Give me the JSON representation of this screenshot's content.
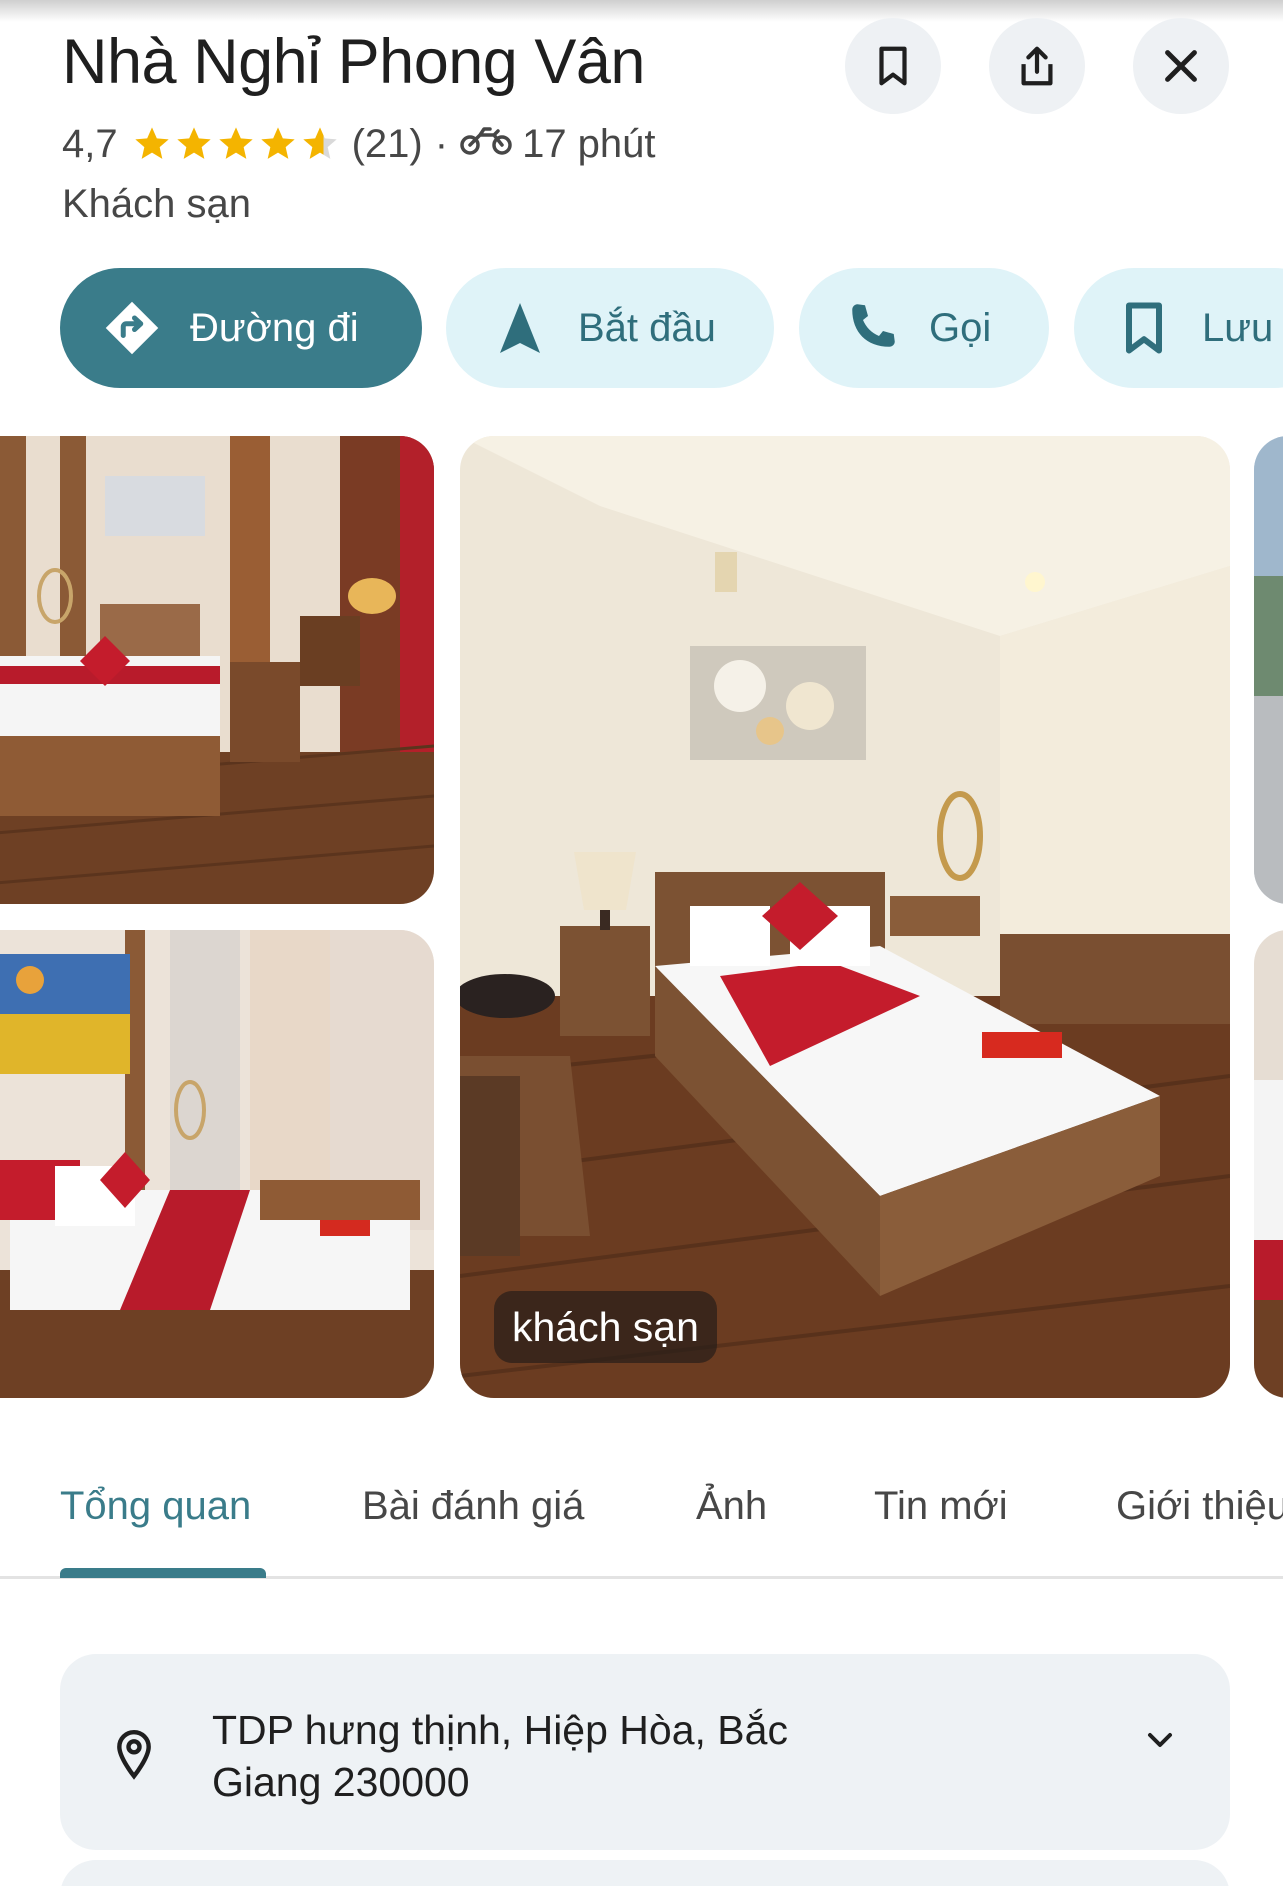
{
  "place": {
    "name": "Nhà Nghỉ Phong Vân",
    "rating": "4,7",
    "stars_value": 4.7,
    "review_count": "(21)",
    "separator": "·",
    "travel_time": "17 phút",
    "travel_mode_icon": "motorbike-icon",
    "category": "Khách sạn"
  },
  "header_buttons": [
    {
      "icon": "bookmark-icon"
    },
    {
      "icon": "share-icon"
    },
    {
      "icon": "close-icon"
    }
  ],
  "actions": [
    {
      "label": "Đường đi",
      "icon": "directions-icon",
      "style": "primary"
    },
    {
      "label": "Bắt đầu",
      "icon": "navigation-arrow-icon",
      "style": "secondary"
    },
    {
      "label": "Gọi",
      "icon": "phone-icon",
      "style": "secondary"
    },
    {
      "label": "Lưu",
      "icon": "bookmark-icon",
      "style": "secondary"
    }
  ],
  "photos": {
    "main_label": "khách sạn"
  },
  "tabs": [
    {
      "label": "Tổng quan",
      "active": true
    },
    {
      "label": "Bài đánh giá",
      "active": false
    },
    {
      "label": "Ảnh",
      "active": false
    },
    {
      "label": "Tin mới",
      "active": false
    },
    {
      "label": "Giới thiệu",
      "active": false
    }
  ],
  "address": {
    "line1": "TDP hưng thịnh, Hiệp Hòa, Bắc",
    "line2": "Giang 230000",
    "icon": "location-pin-icon"
  },
  "colors": {
    "accent": "#3a7c8a",
    "accent_light": "#dff3f8",
    "star": "#f4b400",
    "card_bg": "#eef2f5"
  }
}
